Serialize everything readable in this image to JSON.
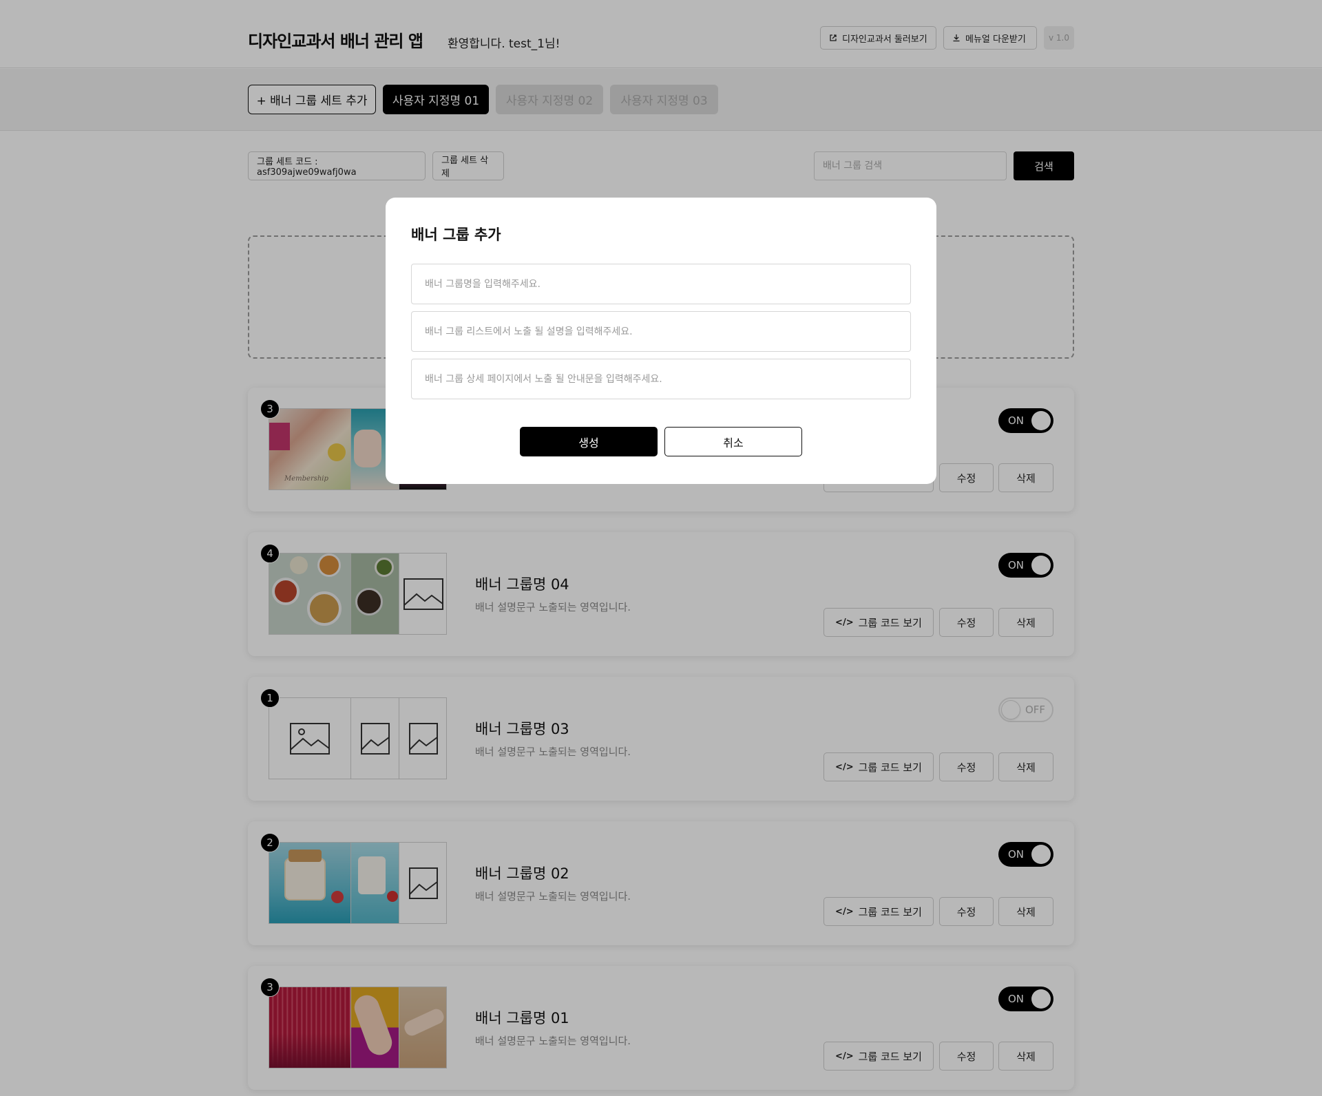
{
  "header": {
    "app_title": "디자인교과서 배너 관리 앱",
    "welcome": "환영합니다. test_1님!",
    "preview_label": "디자인교과서 둘러보기",
    "manual_label": "메뉴얼 다운받기",
    "version": "v 1.0"
  },
  "tabs": {
    "add_label": "+ 배너 그룹 세트 추가",
    "items": [
      {
        "label": "사용자 지정명 01",
        "state": "active"
      },
      {
        "label": "사용자 지정명 02",
        "state": "inactive"
      },
      {
        "label": "사용자 지정명 03",
        "state": "inactive"
      }
    ]
  },
  "toolbar": {
    "set_code_label": "그룹 세트 코드 : asf309ajwe09wafj0wa",
    "delete_set_label": "그룹 세트 삭제",
    "search_placeholder": "배너 그룹 검색",
    "search_button": "검색"
  },
  "cards": [
    {
      "badge": "3",
      "title": "",
      "desc": "",
      "toggle": "ON",
      "thumbs": [
        "photo-membership",
        "photo-nail",
        "photo-pink"
      ]
    },
    {
      "badge": "4",
      "title": "배너 그룹명 04",
      "desc": "배너 설명문구 노출되는 영역입니다.",
      "toggle": "ON",
      "thumbs": [
        "photo-food",
        "photo-food2",
        "placeholder"
      ]
    },
    {
      "badge": "1",
      "title": "배너 그룹명 03",
      "desc": "배너 설명문구 노출되는 영역입니다.",
      "toggle": "OFF",
      "thumbs": [
        "placeholder",
        "placeholder",
        "placeholder"
      ]
    },
    {
      "badge": "2",
      "title": "배너 그룹명 02",
      "desc": "배너 설명문구 노출되는 영역입니다.",
      "toggle": "ON",
      "thumbs": [
        "photo-jar",
        "photo-jar2",
        "placeholder"
      ]
    },
    {
      "badge": "3",
      "title": "배너 그룹명 01",
      "desc": "배너 설명문구 노출되는 영역입니다.",
      "toggle": "ON",
      "thumbs": [
        "photo-red",
        "photo-hand",
        "photo-hand2"
      ]
    }
  ],
  "card_buttons": {
    "code_label": "그룹 코드 보기",
    "edit_label": "수정",
    "delete_label": "삭제"
  },
  "modal": {
    "title": "배너 그룹 추가",
    "name_placeholder": "배너 그룹명을 입력해주세요.",
    "list_desc_placeholder": "배너 그룹 리스트에서 노출 될 설명을 입력해주세요.",
    "detail_desc_placeholder": "배너 그룹 상세 페이지에서 노출 될 안내문을 입력해주세요.",
    "create_label": "생성",
    "cancel_label": "취소"
  },
  "colors": {
    "accent": "#000000",
    "overlay": "rgba(0,0,0,0.28)"
  }
}
